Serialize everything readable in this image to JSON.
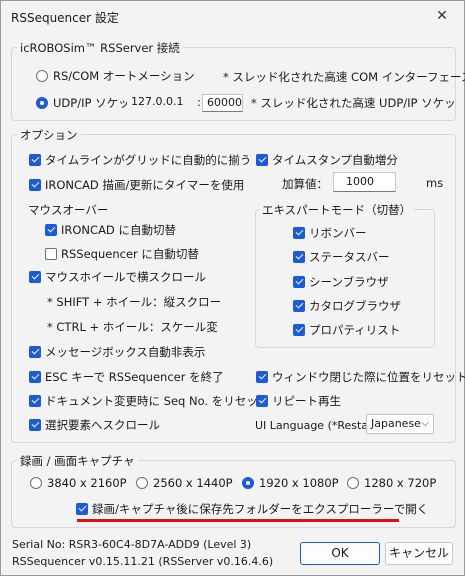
{
  "window": {
    "title": "RSSequencer 設定",
    "close": "✕"
  },
  "server": {
    "legend": "icROBOSim™ RSServer 接続",
    "rs_com": "RS/COM オートメーション",
    "rs_com_note": "* スレッド化された高速 COM インターフェース",
    "udp": "UDP/IP ソケット",
    "ip": "127.0.0.1",
    "colon": ":",
    "port": "60000",
    "udp_note": "* スレッド化された高速 UDP/IP ソケッ"
  },
  "options": {
    "legend": "オプション",
    "snap_grid": "タイムラインがグリッドに自動的に揃う",
    "timer": "IRONCAD 描画/更新にタイマーを使用",
    "timestamp": "タイムスタンプ自動増分",
    "increment_label": "加算値：",
    "increment_value": "1000",
    "increment_unit": "ms",
    "mouseover_label": "マウスオーバー",
    "ironcad_switch": "IRONCAD に自動切替",
    "rss_switch": "RSSequencer に自動切替",
    "wheel_scroll": "マウスホイールで横スクロール",
    "shift_note": "* SHIFT + ホイール：縦スクロー",
    "ctrl_note": "* CTRL + ホイール：スケール変",
    "msgbox": "メッセージボックス自動非表示",
    "esc": "ESC キーで RSSequencer を終了",
    "doc_reset": "ドキュメント変更時に Seq No. をリセット",
    "sel_scroll": "選択要素へスクロール",
    "expert_label": "エキスパートモード（切替）",
    "expert": [
      "リボンバー",
      "ステータスバー",
      "シーンブラウザ",
      "カタログブラウザ",
      "プロパティリスト"
    ],
    "window_reset": "ウィンドウ閉じた際に位置をリセット",
    "repeat": "リピート再生",
    "lang_label": "UI Language (*Restart):",
    "lang_value": "Japanese"
  },
  "capture": {
    "legend": "録画 / 画面キャプチャ",
    "resolutions": [
      "3840 x 2160P",
      "2560 x 1440P",
      "1920 x 1080P",
      "1280 x 720P"
    ],
    "selected": "1920 x 1080P",
    "open_folder": "録画/キャプチャ後に保存先フォルダーをエクスプローラーで開く",
    "highlight_color": "#e0101a"
  },
  "footer": {
    "serial": "Serial No: RSR3-60C4-8D7A-ADD9 (Level 3)",
    "version": "RSSequencer v0.15.11.21 (RSServer v0.16.4.6)",
    "ok": "OK",
    "cancel": "キャンセル"
  },
  "accent": "#1d5ad8"
}
